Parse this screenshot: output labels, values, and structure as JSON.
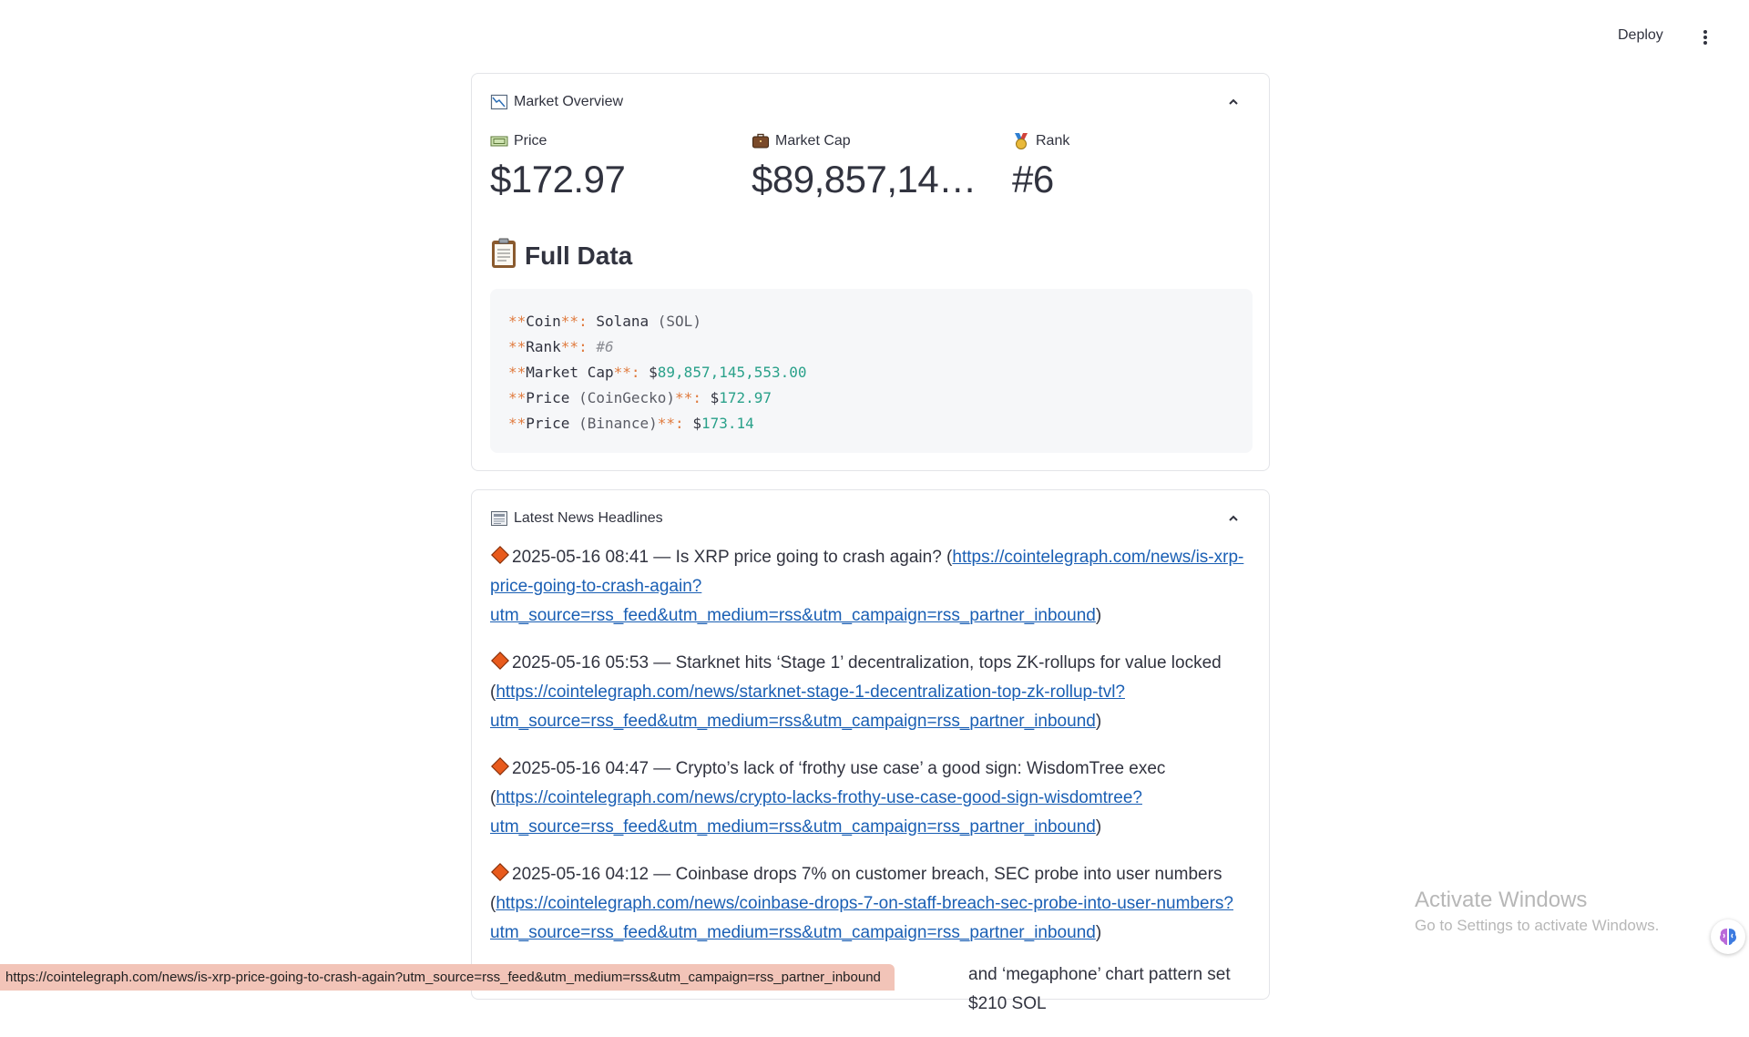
{
  "header": {
    "deploy_label": "Deploy",
    "menu_icon": "kebab-menu-icon"
  },
  "market_overview": {
    "title": "Market Overview",
    "icon": "chart-down-icon",
    "collapse_icon": "chevron-up-icon",
    "metrics": [
      {
        "label": "Price",
        "value": "$172.97",
        "icon": "dollar-bill-icon"
      },
      {
        "label": "Market Cap",
        "value": "$89,857,14…",
        "icon": "briefcase-icon"
      },
      {
        "label": "Rank",
        "value": "#6",
        "icon": "medal-icon"
      }
    ],
    "full_data": {
      "title": "Full Data",
      "icon": "clipboard-icon",
      "lines": [
        {
          "key": "Coin",
          "pre": "",
          "rest": " Solana (SOL)"
        },
        {
          "key": "Rank",
          "pre": "",
          "rest": " #6"
        },
        {
          "key": "Market Cap",
          "pre": "",
          "rest": " $89,857,145,553.00"
        },
        {
          "key": "Price (CoinGecko)",
          "pre": "",
          "rest": " $172.97"
        },
        {
          "key": "Price (Binance)",
          "pre": "",
          "rest": " $173.14"
        }
      ],
      "stars": "**",
      "colon": ":",
      "coin_name": "Solana",
      "coin_sym": "(SOL)",
      "rank": "#6",
      "dollar": "$",
      "market_cap_num": "89,857,145,553.00",
      "price_cg_num": "172.97",
      "price_bn_num": "173.14",
      "k_coin": "Coin",
      "k_rank": "Rank",
      "k_mcap": "Market Cap",
      "k_pcg": "Price",
      "k_pcg_paren": "(CoinGecko)",
      "k_pbn": "Price",
      "k_pbn_paren": "(Binance)"
    }
  },
  "news": {
    "title": "Latest News Headlines",
    "icon": "newspaper-icon",
    "collapse_icon": "chevron-up-icon",
    "items": [
      {
        "text": "2025-05-16 08:41 — Is XRP price going to crash again? (",
        "link": "https://cointelegraph.com/news/is-xrp-price-going-to-crash-again?utm_source=rss_feed&utm_medium=rss&utm_campaign=rss_partner_inbound",
        "link_parts": [
          "https://cointelegraph.com/news/is-xrp-",
          "price-going-to-crash-again?",
          "utm_source=rss_feed&utm_medium=rss&utm_campaign=rss_partner_inbound"
        ],
        "close": ")"
      },
      {
        "text": "2025-05-16 05:53 — Starknet hits ‘Stage 1’ decentralization, tops ZK-rollups for value locked",
        "open": "(",
        "link_parts": [
          "https://cointelegraph.com/news/starknet-stage-1-decentralization-top-zk-rollup-tvl?",
          "utm_source=rss_feed&utm_medium=rss&utm_campaign=rss_partner_inbound"
        ],
        "close": ")"
      },
      {
        "text": "2025-05-16 04:47 — Crypto’s lack of ‘frothy use case’ a good sign: WisdomTree exec",
        "open": "(",
        "link_parts": [
          "https://cointelegraph.com/news/crypto-lacks-frothy-use-case-good-sign-wisdomtree?",
          "utm_source=rss_feed&utm_medium=rss&utm_campaign=rss_partner_inbound"
        ],
        "close": ")"
      },
      {
        "text": "2025-05-16 04:12 — Coinbase drops 7% on customer breach, SEC probe into user numbers",
        "open": "(",
        "link_parts": [
          "https://cointelegraph.com/news/coinbase-drops-7-on-staff-breach-sec-probe-into-user-numbers?",
          "utm_source=rss_feed&utm_medium=rss&utm_campaign=rss_partner_inbound"
        ],
        "close": ")"
      },
      {
        "text_tail": "and ‘megaphone’ chart pattern set $210 SOL"
      }
    ]
  },
  "status_bar_url": "https://cointelegraph.com/news/is-xrp-price-going-to-crash-again?utm_source=rss_feed&utm_medium=rss&utm_campaign=rss_partner_inbound",
  "watermark": {
    "line1": "Activate Windows",
    "line2": "Go to Settings to activate Windows."
  },
  "floating_icon": "brain-icon"
}
